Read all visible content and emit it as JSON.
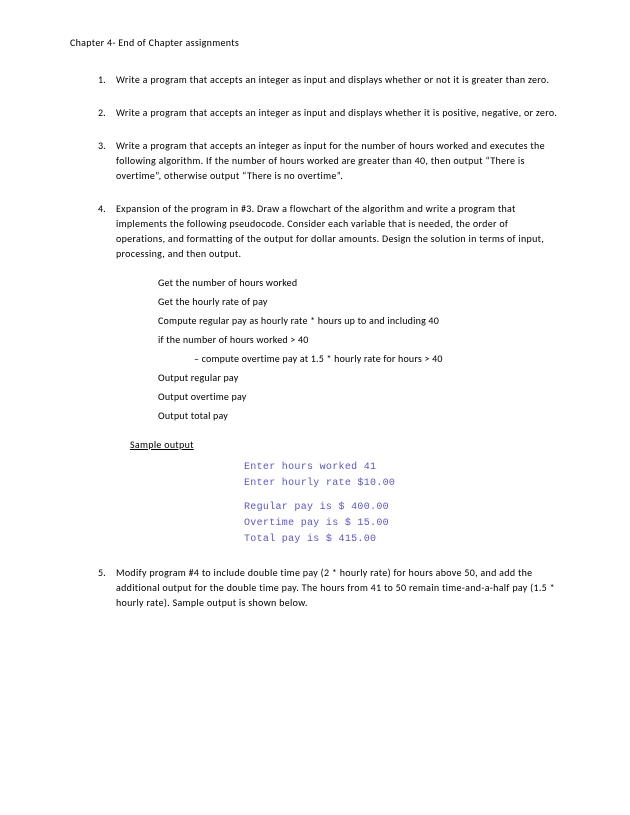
{
  "title": "Chapter 4- End of Chapter assignments",
  "items": [
    {
      "num": "1.",
      "text": "Write a program that accepts an integer as input and displays whether or not it is greater than zero."
    },
    {
      "num": "2.",
      "text": "Write a program that accepts an integer as input and displays whether it is positive, negative, or zero."
    },
    {
      "num": "3.",
      "text": "Write a program that accepts an integer as input for the number of hours worked and executes the following algorithm.  If the number of hours worked are greater than 40, then output “There is overtime”, otherwise output “There is no overtime”."
    },
    {
      "num": "4.",
      "text": "Expansion of the program in #3.  Draw a flowchart of the algorithm and write a program that implements the following pseudocode.  Consider each variable that is needed, the order of operations, and formatting of the output for dollar amounts.  Design the solution in terms of input, processing, and then output."
    },
    {
      "num": "5.",
      "text": "Modify program #4 to include double time pay (2 * hourly rate) for hours above 50, and add the additional output for the double time pay.  The hours from 41 to 50 remain time-and-a-half pay (1.5 * hourly rate). Sample output is shown below."
    }
  ],
  "pseudocode": [
    {
      "text": "Get the number of hours worked",
      "indent": false
    },
    {
      "text": "Get the hourly rate of pay",
      "indent": false
    },
    {
      "text": "Compute regular pay as hourly rate * hours up to and including 40",
      "indent": false
    },
    {
      "text": "if the number of hours worked > 40",
      "indent": false
    },
    {
      "text": "– compute overtime pay at 1.5 * hourly rate for hours > 40",
      "indent": true
    },
    {
      "text": "Output regular pay",
      "indent": false
    },
    {
      "text": "Output overtime pay",
      "indent": false
    },
    {
      "text": "Output total pay",
      "indent": false
    }
  ],
  "sample_heading": "Sample output",
  "sample_output": {
    "block1": [
      "Enter hours worked 41",
      "Enter hourly rate $10.00"
    ],
    "block2": [
      "Regular pay is $ 400.00",
      "Overtime pay is $ 15.00",
      "Total pay is $ 415.00"
    ]
  }
}
